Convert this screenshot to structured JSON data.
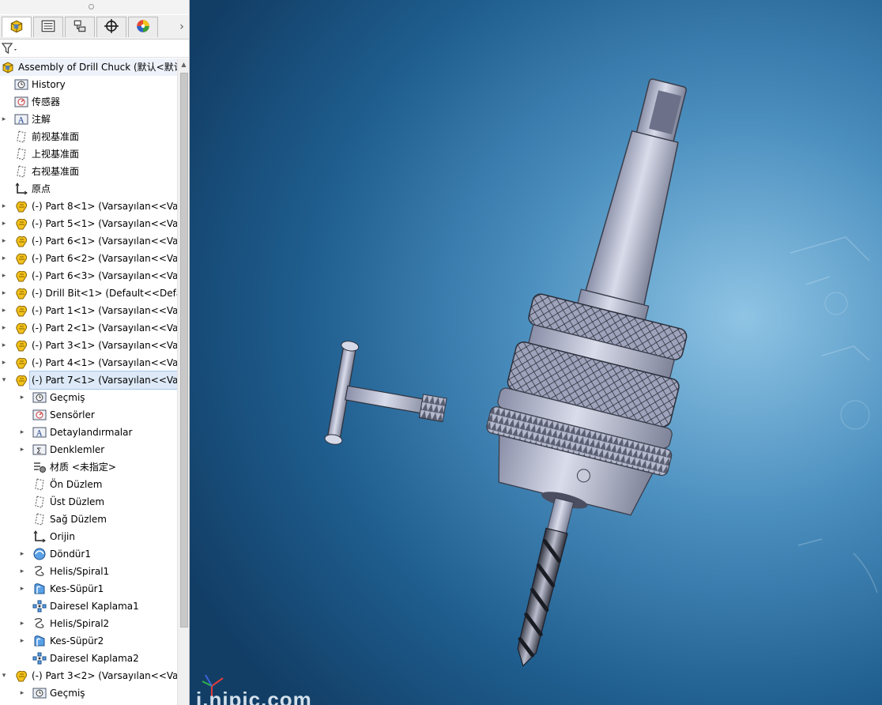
{
  "panel": {
    "tabs": [
      {
        "name": "featuremanager-tab",
        "icon": "assembly-cube-icon",
        "active": true
      },
      {
        "name": "propertymanager-tab",
        "icon": "property-list-icon",
        "active": false
      },
      {
        "name": "configurationmanager-tab",
        "icon": "configuration-icon",
        "active": false
      },
      {
        "name": "dimxpert-tab",
        "icon": "crosshair-icon",
        "active": false
      },
      {
        "name": "display-manager-tab",
        "icon": "color-wheel-icon",
        "active": false
      }
    ],
    "tabs_more": "›",
    "splitter_glyph": "⋮",
    "scroll_up_glyph": "▲"
  },
  "tree": [
    {
      "label": "Assembly of Drill Chuck  (默认<默认",
      "icon": "assembly-cube-icon",
      "level": 0,
      "expander": "",
      "top": true
    },
    {
      "label": "History",
      "icon": "history-icon",
      "level": 1,
      "expander": ""
    },
    {
      "label": "传感器",
      "icon": "sensor-icon",
      "level": 1,
      "expander": ""
    },
    {
      "label": "注解",
      "icon": "annotation-icon",
      "level": 1,
      "expander": "▸"
    },
    {
      "label": "前视基准面",
      "icon": "plane-icon",
      "level": 1,
      "expander": ""
    },
    {
      "label": "上视基准面",
      "icon": "plane-icon",
      "level": 1,
      "expander": ""
    },
    {
      "label": "右视基准面",
      "icon": "plane-icon",
      "level": 1,
      "expander": ""
    },
    {
      "label": "原点",
      "icon": "origin-icon",
      "level": 1,
      "expander": ""
    },
    {
      "label": "(-) Part 8<1> (Varsayılan<<Var",
      "icon": "part-icon",
      "level": 1,
      "expander": "▸"
    },
    {
      "label": "(-) Part 5<1> (Varsayılan<<Var",
      "icon": "part-icon",
      "level": 1,
      "expander": "▸"
    },
    {
      "label": "(-) Part 6<1> (Varsayılan<<Var",
      "icon": "part-icon",
      "level": 1,
      "expander": "▸"
    },
    {
      "label": "(-) Part 6<2> (Varsayılan<<Var",
      "icon": "part-icon",
      "level": 1,
      "expander": "▸"
    },
    {
      "label": "(-) Part 6<3> (Varsayılan<<Var",
      "icon": "part-icon",
      "level": 1,
      "expander": "▸"
    },
    {
      "label": "(-) Drill Bit<1> (Default<<Defau",
      "icon": "part-icon",
      "level": 1,
      "expander": "▸"
    },
    {
      "label": "(-) Part 1<1> (Varsayılan<<Var",
      "icon": "part-icon",
      "level": 1,
      "expander": "▸"
    },
    {
      "label": "(-) Part 2<1> (Varsayılan<<Var",
      "icon": "part-icon",
      "level": 1,
      "expander": "▸"
    },
    {
      "label": "(-) Part 3<1> (Varsayılan<<Var",
      "icon": "part-icon",
      "level": 1,
      "expander": "▸"
    },
    {
      "label": "(-) Part 4<1> (Varsayılan<<Var",
      "icon": "part-icon",
      "level": 1,
      "expander": "▸"
    },
    {
      "label": "(-) Part 7<1> (Varsayılan<<Var",
      "icon": "part-icon",
      "level": 1,
      "expander": "▾",
      "selected": true
    },
    {
      "label": "Geçmiş",
      "icon": "history-icon",
      "level": 2,
      "expander": "▸"
    },
    {
      "label": "Sensörler",
      "icon": "sensor-icon",
      "level": 2,
      "expander": ""
    },
    {
      "label": "Detaylandırmalar",
      "icon": "annotation-icon",
      "level": 2,
      "expander": "▸"
    },
    {
      "label": "Denklemler",
      "icon": "equation-icon",
      "level": 2,
      "expander": "▸"
    },
    {
      "label": "材质 <未指定>",
      "icon": "material-icon",
      "level": 2,
      "expander": ""
    },
    {
      "label": "Ön Düzlem",
      "icon": "plane-icon",
      "level": 2,
      "expander": ""
    },
    {
      "label": "Üst Düzlem",
      "icon": "plane-icon",
      "level": 2,
      "expander": ""
    },
    {
      "label": "Sağ Düzlem",
      "icon": "plane-icon",
      "level": 2,
      "expander": ""
    },
    {
      "label": "Orijin",
      "icon": "origin-icon",
      "level": 2,
      "expander": ""
    },
    {
      "label": "Döndür1",
      "icon": "revolve-icon",
      "level": 2,
      "expander": "▸"
    },
    {
      "label": "Helis/Spiral1",
      "icon": "helix-icon",
      "level": 2,
      "expander": "▸"
    },
    {
      "label": "Kes-Süpür1",
      "icon": "sweep-cut-icon",
      "level": 2,
      "expander": "▸"
    },
    {
      "label": "Dairesel Kaplama1",
      "icon": "circular-pattern-icon",
      "level": 2,
      "expander": ""
    },
    {
      "label": "Helis/Spiral2",
      "icon": "helix-icon",
      "level": 2,
      "expander": "▸"
    },
    {
      "label": "Kes-Süpür2",
      "icon": "sweep-cut-icon",
      "level": 2,
      "expander": "▸"
    },
    {
      "label": "Dairesel Kaplama2",
      "icon": "circular-pattern-icon",
      "level": 2,
      "expander": ""
    },
    {
      "label": "(-) Part 3<2> (Varsayılan<<Var",
      "icon": "part-icon",
      "level": 1,
      "expander": "▾"
    },
    {
      "label": "Geçmiş",
      "icon": "history-icon",
      "level": 2,
      "expander": "▸"
    }
  ],
  "viewport": {
    "watermark": "i.nipic.com",
    "model": "drill-chuck-assembly"
  },
  "colors": {
    "selection": "#dde9f7",
    "part_yellow": "#f2c21b",
    "viewport_dark": "#123e66",
    "viewport_light": "#8fc4e4",
    "metal": "#c9cde0"
  }
}
